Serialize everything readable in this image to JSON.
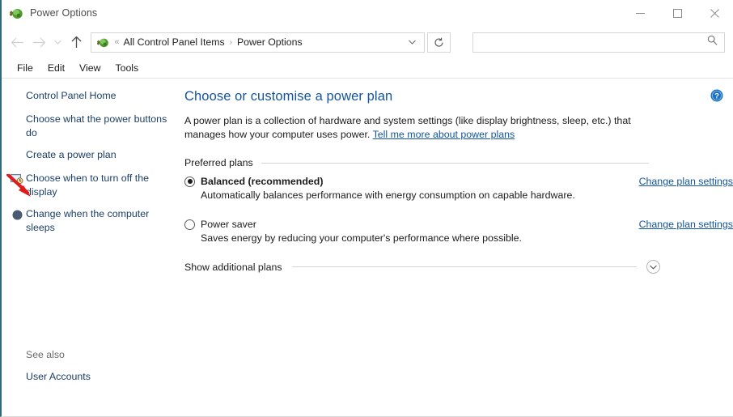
{
  "window": {
    "title": "Power Options",
    "icon": "power-plug-icon",
    "controls": {
      "minimize": "minimize-icon",
      "maximize": "maximize-icon",
      "close": "close-icon"
    }
  },
  "navbar": {
    "back": "back-arrow-icon",
    "forward": "forward-arrow-icon",
    "recent": "chevron-down-icon",
    "up": "up-arrow-icon",
    "address": {
      "icon": "power-plug-icon",
      "overflow": "«",
      "crumb1": "All Control Panel Items",
      "separator": "›",
      "crumb2": "Power Options",
      "dropdown": "chevron-down-icon"
    },
    "refresh": "refresh-icon",
    "search": {
      "value": "",
      "placeholder": "",
      "icon": "search-icon"
    }
  },
  "menubar": {
    "items": [
      {
        "label": "File"
      },
      {
        "label": "Edit"
      },
      {
        "label": "View"
      },
      {
        "label": "Tools"
      }
    ]
  },
  "sidebar": {
    "items": [
      {
        "label": "Control Panel Home",
        "icon": ""
      },
      {
        "label": "Choose what the power buttons do",
        "icon": ""
      },
      {
        "label": "Create a power plan",
        "icon": ""
      },
      {
        "label": "Choose when to turn off the display",
        "icon": "monitor-clock-icon"
      },
      {
        "label": "Change when the computer sleeps",
        "icon": "moon-sleep-icon"
      }
    ],
    "see_also": {
      "heading": "See also",
      "link": "User Accounts"
    },
    "annotation": {
      "type": "red-arrow",
      "points_to": "Choose what the power buttons do",
      "color": "#e01b1b"
    }
  },
  "main": {
    "help": "help-icon",
    "title": "Choose or customise a power plan",
    "intro_before": "A power plan is a collection of hardware and system settings (like display brightness, sleep, etc.) that manages how your computer uses power. ",
    "intro_link": "Tell me more about power plans",
    "preferred_plans_label": "Preferred plans",
    "plans": [
      {
        "name": "Balanced (recommended)",
        "description": "Automatically balances performance with energy consumption on capable hardware.",
        "selected": true,
        "link": "Change plan settings"
      },
      {
        "name": "Power saver",
        "description": "Saves energy by reducing your computer's performance where possible.",
        "selected": false,
        "link": "Change plan settings"
      }
    ],
    "show_additional": {
      "label": "Show additional plans",
      "icon": "chevron-down-circle-icon"
    }
  },
  "colors": {
    "link": "#13559c",
    "title": "#13559c",
    "sidebar_link": "#1b3f66",
    "accent_border": "#2e6b78",
    "annotation": "#e01b1b"
  }
}
